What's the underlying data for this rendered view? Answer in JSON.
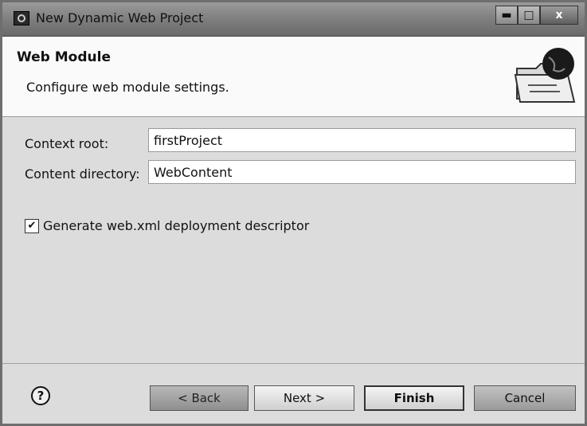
{
  "window": {
    "title": "New Dynamic Web Project",
    "minimize_icon": "minimize-icon",
    "maximize_icon": "maximize-icon",
    "close_label": "x"
  },
  "header": {
    "title": "Web Module",
    "description": "Configure web module settings.",
    "icon": "web-folder-globe-icon"
  },
  "form": {
    "context_root_label": "Context root:",
    "context_root_value": "firstProject",
    "content_directory_label": "Content directory:",
    "content_directory_value": "WebContent",
    "generate_xml_label": "Generate web.xml deployment descriptor",
    "generate_xml_checked": true
  },
  "footer": {
    "help_label": "?",
    "back_label": "< Back",
    "next_label": "Next >",
    "finish_label": "Finish",
    "cancel_label": "Cancel"
  }
}
